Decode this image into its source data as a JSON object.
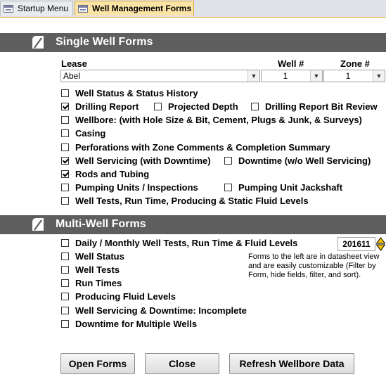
{
  "tabs": [
    {
      "label": "Startup Menu",
      "active": false
    },
    {
      "label": "Well Management Forms",
      "active": true
    }
  ],
  "single": {
    "title": "Single Well Forms",
    "lease_label": "Lease",
    "well_label": "Well #",
    "zone_label": "Zone #",
    "lease_value": "Abel",
    "well_value": "1",
    "zone_value": "1",
    "items": [
      {
        "label": "Well Status & Status History",
        "checked": false
      },
      {
        "label": "Drilling Report",
        "checked": true
      },
      {
        "label": "Projected Depth",
        "checked": false
      },
      {
        "label": "Drilling Report Bit Review",
        "checked": false
      },
      {
        "label": "Wellbore: (with Hole Size & Bit, Cement, Plugs & Junk,  & Surveys)",
        "checked": false
      },
      {
        "label": "Casing",
        "checked": false
      },
      {
        "label": "Perforations with Zone Comments & Completion Summary",
        "checked": false
      },
      {
        "label": "Well Servicing  (with Downtime)",
        "checked": true
      },
      {
        "label": "Downtime  (w/o Well Servicing)",
        "checked": false
      },
      {
        "label": "Rods and Tubing",
        "checked": true
      },
      {
        "label": "Pumping Units / Inspections",
        "checked": false
      },
      {
        "label": "Pumping Unit Jackshaft",
        "checked": false
      },
      {
        "label": "Well Tests, Run Time, Producing & Static Fluid Levels",
        "checked": false
      }
    ]
  },
  "multi": {
    "title": "Multi-Well Forms",
    "period_value": "201611",
    "note": "Forms to the left are in datasheet view and are easily customizable (Filter by Form, hide fields, filter, and sort).",
    "items": [
      {
        "label": "Daily / Monthly Well Tests, Run Time & Fluid Levels",
        "checked": false
      },
      {
        "label": "Well Status",
        "checked": false
      },
      {
        "label": "Well Tests",
        "checked": false
      },
      {
        "label": "Run Times",
        "checked": false
      },
      {
        "label": "Producing Fluid Levels",
        "checked": false
      },
      {
        "label": "Well Servicing & Downtime: Incomplete",
        "checked": false
      },
      {
        "label": "Downtime for Multiple Wells",
        "checked": false
      }
    ]
  },
  "buttons": {
    "open": "Open Forms",
    "close": "Close",
    "refresh": "Refresh Wellbore Data"
  },
  "colors": {
    "section_header": "#5e5e5e",
    "active_tab": "#fbe3a6",
    "spinner_arrow": "#f2c200"
  }
}
